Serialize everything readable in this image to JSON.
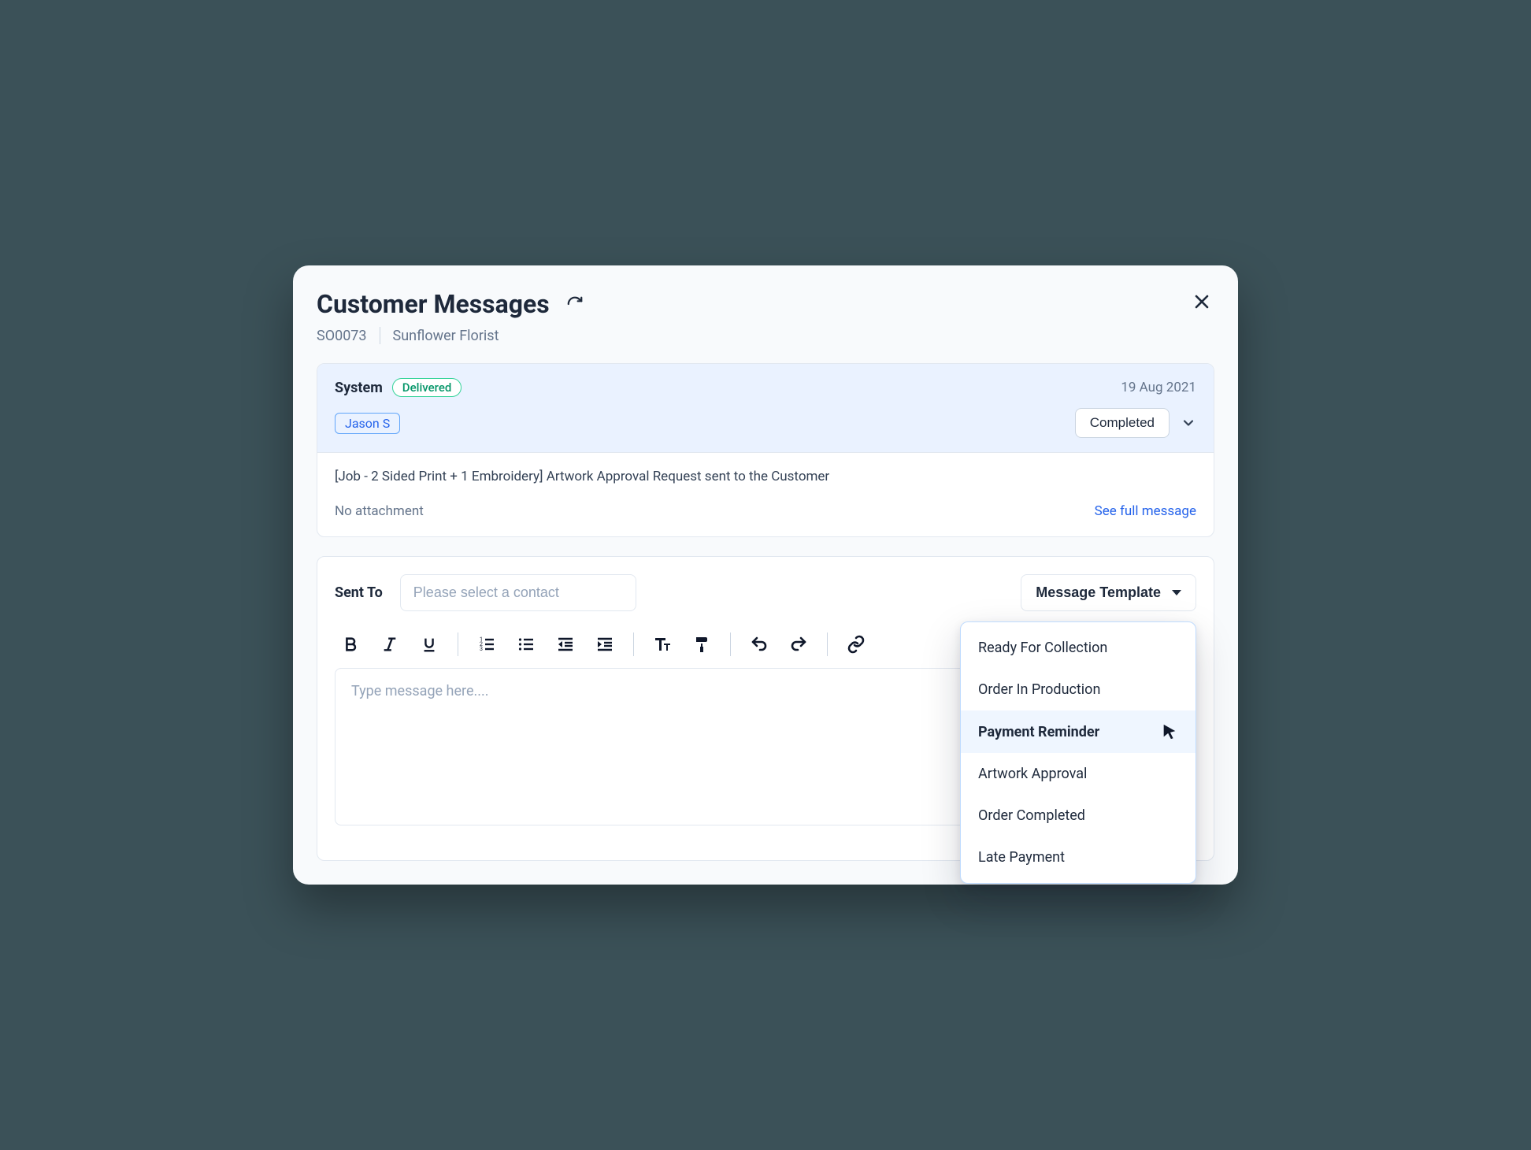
{
  "modal": {
    "title": "Customer Messages",
    "order_id": "SO0073",
    "customer_name": "Sunflower Florist"
  },
  "message": {
    "sender": "System",
    "status_badge": "Delivered",
    "date": "19 Aug 2021",
    "recipient_tag": "Jason S",
    "state_button": "Completed",
    "body": "[Job - 2 Sided Print + 1 Embroidery] Artwork Approval Request sent to the Customer",
    "attachment_text": "No attachment",
    "see_full": "See full message"
  },
  "compose": {
    "sent_to_label": "Sent To",
    "contact_placeholder": "Please select a contact",
    "template_button": "Message Template",
    "editor_placeholder": "Type message here....",
    "template_options": [
      "Ready For Collection",
      "Order In Production",
      "Payment Reminder",
      "Artwork Approval",
      "Order Completed",
      "Late Payment"
    ],
    "hovered_option_index": 2
  }
}
